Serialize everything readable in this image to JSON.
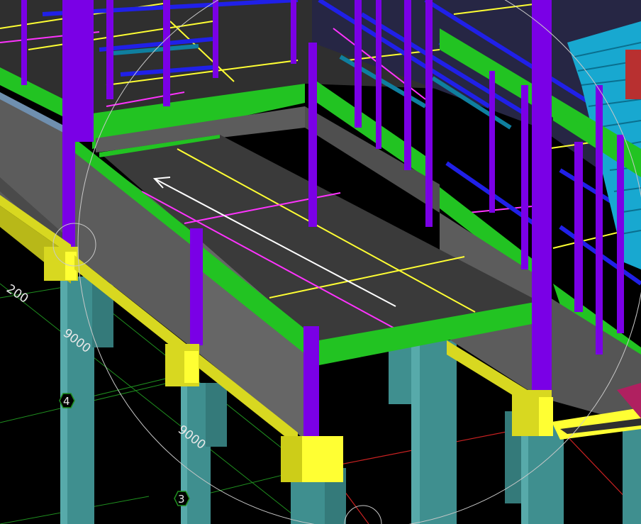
{
  "view": {
    "dimensions": [
      "200",
      "9000",
      "9000"
    ],
    "grid_markers": [
      "4",
      "3"
    ]
  },
  "colors": {
    "background": "#000000",
    "column": "#7a00e6",
    "beam": "#22c322",
    "slab": "#3a3a3a",
    "wall": "#5c5c5c",
    "pile": "#3f8f8f",
    "pile_cap": "#d8d820",
    "brace": "#2020e8",
    "stair": "#20c8e8",
    "marker_yellow": "#ffff33",
    "marker_magenta": "#ff33ff",
    "grid_green": "#1f8f1f",
    "grid_red": "#cc2222",
    "orbit": "#c8c8c8"
  },
  "icons": {
    "navigation_arrow": "arrow-left",
    "orbit_ring": "circle"
  }
}
